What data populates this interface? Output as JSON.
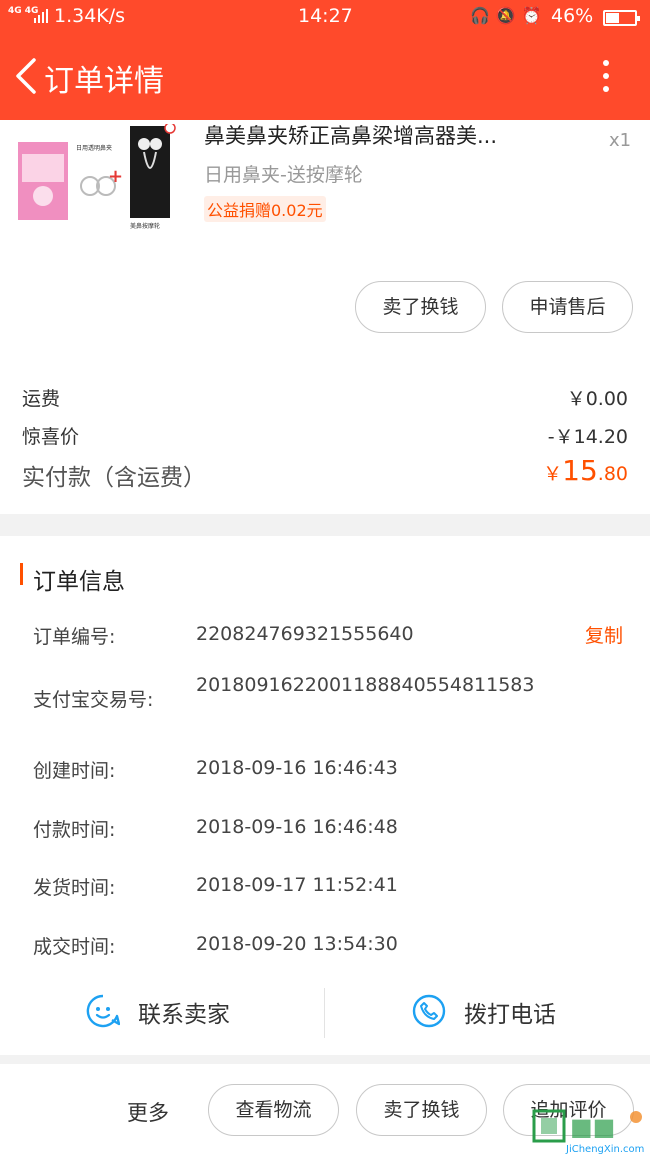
{
  "status_bar": {
    "signal": "4G 4G",
    "speed": "1.34K/s",
    "time": "14:27",
    "battery": "46%",
    "battery_level": 0.46,
    "icons": [
      "headset-icon",
      "mute-bell-icon",
      "alarm-icon"
    ]
  },
  "header": {
    "title": "订单详情",
    "background": "#ff4a2b"
  },
  "product": {
    "name": "鼻美鼻夹矫正高鼻梁增高器美...",
    "qty": "x1",
    "spec": "日用鼻夹-送按摩轮",
    "charity_tag": "公益捐赠0.02元",
    "image_text": [
      "日用透明鼻夹",
      "美鼻按摩轮"
    ],
    "actions": {
      "sell": "卖了换钱",
      "after_sales": "申请售后"
    }
  },
  "fees": {
    "shipping_label": "运费",
    "shipping_value": "￥0.00",
    "discount_label": "惊喜价",
    "discount_value": "-￥14.20",
    "paid_label": "实付款（含运费）",
    "paid_currency": "￥",
    "paid_int": "15",
    "paid_dec": ".80"
  },
  "order_info": {
    "title": "订单信息",
    "copy": "复制",
    "rows": [
      {
        "label": "订单编号:",
        "value": "220824769321555640"
      },
      {
        "label": "支付宝交易号:",
        "value": "2018091622001188840554811583"
      },
      {
        "label": "创建时间:",
        "value": "2018-09-16 16:46:43"
      },
      {
        "label": "付款时间:",
        "value": "2018-09-16 16:46:48"
      },
      {
        "label": "发货时间:",
        "value": "2018-09-17 11:52:41"
      },
      {
        "label": "成交时间:",
        "value": "2018-09-20 13:54:30"
      }
    ],
    "contact_seller": "联系卖家",
    "call_phone": "拨打电话"
  },
  "bottom": {
    "more": "更多",
    "logistics": "查看物流",
    "sell": "卖了换钱",
    "review": "追加评价"
  },
  "watermark": {
    "text": "JiChengXin.com"
  },
  "colors": {
    "accent": "#ff4a2b",
    "price": "#ff5000",
    "icon_blue": "#1da1f2"
  }
}
